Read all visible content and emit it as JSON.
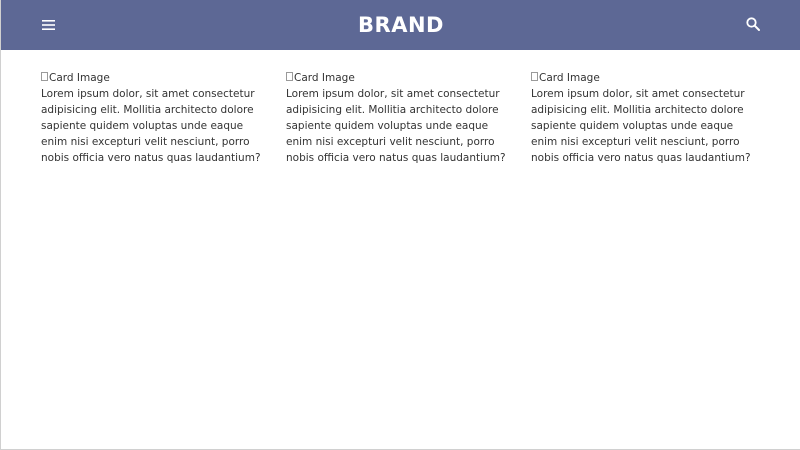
{
  "header": {
    "brand": "BRAND",
    "menu_icon": "hamburger-menu-icon",
    "search_icon": "search-icon",
    "background": "#5d6895"
  },
  "cards": [
    {
      "image_alt": "Card Image",
      "text": "Lorem ipsum dolor, sit amet consectetur adipisicing elit. Mollitia architecto dolore sapiente quidem voluptas unde eaque enim nisi excepturi velit nesciunt, porro nobis officia vero natus quas laudantium?"
    },
    {
      "image_alt": "Card Image",
      "text": "Lorem ipsum dolor, sit amet consectetur adipisicing elit. Mollitia architecto dolore sapiente quidem voluptas unde eaque enim nisi excepturi velit nesciunt, porro nobis officia vero natus quas laudantium?"
    },
    {
      "image_alt": "Card Image",
      "text": "Lorem ipsum dolor, sit amet consectetur adipisicing elit. Mollitia architecto dolore sapiente quidem voluptas unde eaque enim nisi excepturi velit nesciunt, porro nobis officia vero natus quas laudantium?"
    }
  ]
}
